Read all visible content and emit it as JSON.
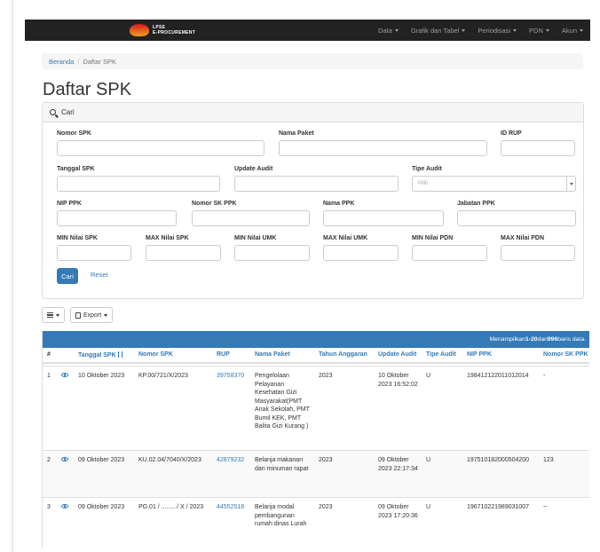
{
  "navbar": {
    "brand_line1": "LPSE",
    "brand_line2": "E-PROCUREMENT",
    "menu": [
      {
        "label": "Data"
      },
      {
        "label": "Grafik dan Tabel"
      },
      {
        "label": "Periodisasi"
      },
      {
        "label": "PDN"
      },
      {
        "label": "Akun"
      }
    ]
  },
  "breadcrumb": {
    "home": "Beranda",
    "current": "Daftar SPK"
  },
  "page_title": "Daftar SPK",
  "search": {
    "heading": "Cari",
    "labels": {
      "nomor_spk": "Nomor SPK",
      "nama_paket": "Nama Paket",
      "id_rup": "ID RUP",
      "tanggal_spk": "Tanggal SPK",
      "update_audit": "Update Audit",
      "tipe_audit": "Tipe Audit",
      "nip_ppk": "NIP PPK",
      "nomor_sk_ppk": "Nomor SK PPK",
      "nama_ppk": "Nama PPK",
      "jabatan_ppk": "Jabatan PPK",
      "min_nilai_spk": "MIN Nilai SPK",
      "max_nilai_spk": "MAX Nilai SPK",
      "min_nilai_umk": "MIN Nilai UMK",
      "max_nilai_umk": "MAX Nilai UMK",
      "min_nilai_pdn": "MIN Nilai PDN",
      "max_nilai_pdn": "MAX Nilai PDN"
    },
    "tipe_audit_placeholder": "Pilih",
    "btn_cari": "Cari",
    "btn_reset": "Reset"
  },
  "toolbar": {
    "export_label": "Export"
  },
  "table": {
    "summary_prefix": "Menampilkan ",
    "summary_range": "1-20",
    "summary_mid": " dari ",
    "summary_total": "996",
    "summary_suffix": " baris data.",
    "headers": [
      "#",
      "Tanggal SPK",
      "Nomor SPK",
      "RUP",
      "Nama Paket",
      "Tahun Anggaran",
      "Update Audit",
      "Tipe Audit",
      "NIP PPK",
      "Nomor SK PPK"
    ],
    "rows": [
      {
        "no": "1",
        "tanggal": "10 Oktober 2023",
        "nomor": "KP.00/721/X/2023",
        "rup": "39758370",
        "nama_paket": "Pengelolaan Pelayanan Kesehatan Gizi Masyarakat(PMT Anak Sekolah, PMT Bumil KEK, PMT Balita Gizi Kurang )",
        "tahun": "2023",
        "update": "10 Oktober 2023 16:52:02",
        "tipe": "U",
        "nip": "198412122011012014",
        "sk": "-"
      },
      {
        "no": "2",
        "tanggal": "09 Oktober 2023",
        "nomor": "KU.02.04/7040/X/2023",
        "rup": "42879232",
        "nama_paket": "Belanja makanan dan minuman rapat",
        "tahun": "2023",
        "update": "09 Oktober 2023 22:17:34",
        "tipe": "U",
        "nip": "197510182000504200",
        "sk": "123"
      },
      {
        "no": "3",
        "tanggal": "09 Oktober 2023",
        "nomor": "PG.01 / ........ / X / 2023",
        "rup": "44552518",
        "nama_paket": "Belanja modal pembangunan rumah dinas Lurah",
        "tahun": "2023",
        "update": "09 Oktober 2023 17:20:36",
        "tipe": "U",
        "nip": "196710221989031007",
        "sk": "--"
      }
    ]
  }
}
